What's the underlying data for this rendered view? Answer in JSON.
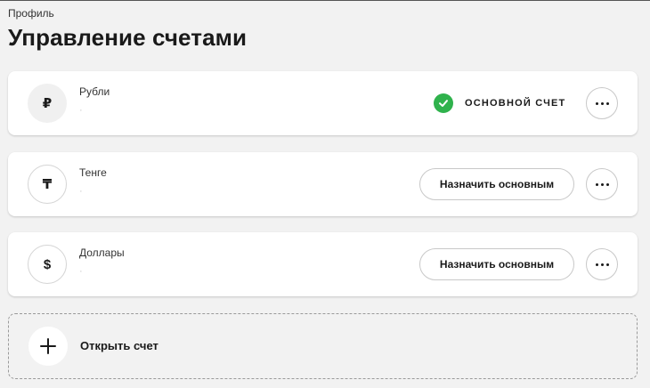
{
  "breadcrumb": "Профиль",
  "page_title": "Управление счетами",
  "accounts": [
    {
      "symbol": "₽",
      "name": "Рубли",
      "number": "·",
      "is_primary": true,
      "primary_label": "ОСНОВНОЙ СЧЕТ",
      "primary_icon": "check-icon",
      "more_icon": "more-dots-icon"
    },
    {
      "symbol": "₸",
      "name": "Тенге",
      "number": "·",
      "is_primary": false,
      "set_primary_label": "Назначить основным",
      "more_icon": "more-dots-icon"
    },
    {
      "symbol": "$",
      "name": "Доллары",
      "number": "·",
      "is_primary": false,
      "set_primary_label": "Назначить основным",
      "more_icon": "more-dots-icon"
    }
  ],
  "open_account": {
    "label": "Открыть счет",
    "icon": "plus-icon"
  },
  "colors": {
    "background": "#f2f2f2",
    "card": "#ffffff",
    "primary_check": "#2fb24c",
    "text": "#1a1a1a"
  }
}
